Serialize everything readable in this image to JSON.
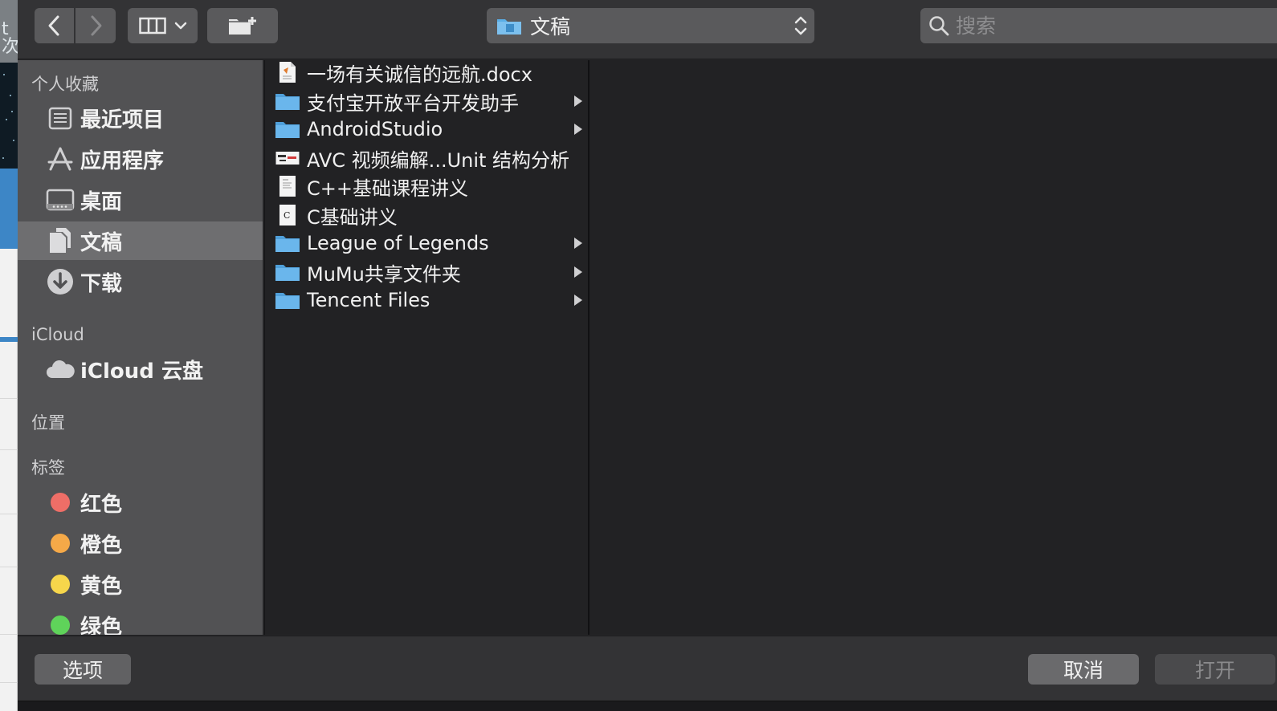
{
  "desktop": {
    "edge_text": "t 次"
  },
  "toolbar": {
    "path_label": "文稿",
    "search_placeholder": "搜索"
  },
  "sidebar": {
    "favorites_header": "个人收藏",
    "favorites": [
      {
        "label": "最近项目",
        "icon": "recents-icon"
      },
      {
        "label": "应用程序",
        "icon": "applications-icon"
      },
      {
        "label": "桌面",
        "icon": "desktop-icon"
      },
      {
        "label": "文稿",
        "icon": "documents-icon",
        "selected": true
      },
      {
        "label": "下载",
        "icon": "downloads-icon"
      }
    ],
    "icloud_header": "iCloud",
    "icloud": [
      {
        "label": "iCloud 云盘",
        "icon": "cloud-icon"
      }
    ],
    "locations_header": "位置",
    "tags_header": "标签",
    "tags": [
      {
        "label": "红色",
        "color": "#ee6e67"
      },
      {
        "label": "橙色",
        "color": "#f5a948"
      },
      {
        "label": "黄色",
        "color": "#f6d64b"
      },
      {
        "label": "绿色",
        "color": "#5fd35a"
      }
    ]
  },
  "files": [
    {
      "name": "一场有关诚信的远航.docx",
      "kind": "docx-file",
      "has_children": false
    },
    {
      "name": "支付宝开放平台开发助手",
      "kind": "folder",
      "has_children": true
    },
    {
      "name": "AndroidStudio",
      "kind": "folder",
      "has_children": true
    },
    {
      "name": "AVC 视频编解...Unit 结构分析",
      "kind": "image-file",
      "has_children": false
    },
    {
      "name": "C++基础课程讲义",
      "kind": "document-file",
      "has_children": false
    },
    {
      "name": "C基础讲义",
      "kind": "document-file",
      "has_children": false
    },
    {
      "name": "League of Legends",
      "kind": "folder",
      "has_children": true
    },
    {
      "name": "MuMu共享文件夹",
      "kind": "folder",
      "has_children": true
    },
    {
      "name": "Tencent Files",
      "kind": "folder",
      "has_children": true
    }
  ],
  "bottom": {
    "options_label": "选项",
    "cancel_label": "取消",
    "open_label": "打开"
  },
  "colors": {
    "folder_blue": "#5aaee6",
    "selection": "#6e6e70"
  }
}
